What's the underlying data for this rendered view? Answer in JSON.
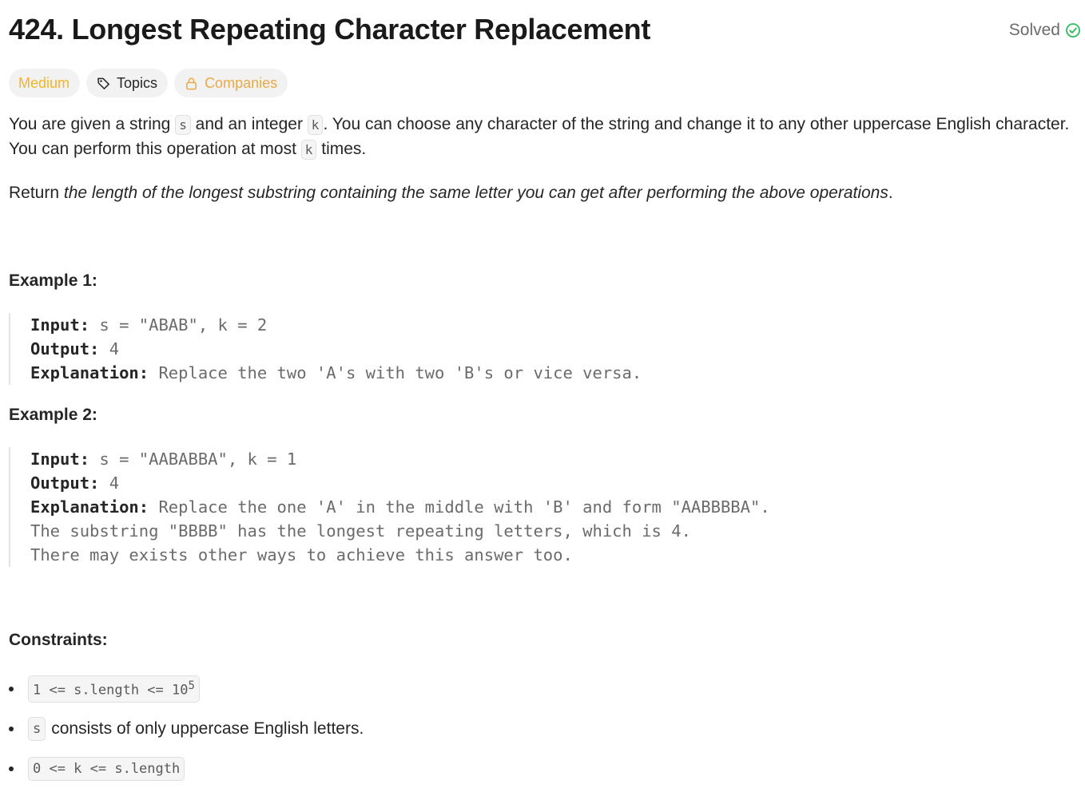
{
  "problem": {
    "title": "424. Longest Repeating Character Replacement",
    "status": "Solved",
    "tags": {
      "difficulty": "Medium",
      "topics": "Topics",
      "companies": "Companies"
    },
    "description": {
      "p1_a": "You are given a string ",
      "p1_code1": "s",
      "p1_b": " and an integer ",
      "p1_code2": "k",
      "p1_c": ". You can choose any character of the string and change it to any other uppercase English character. You can perform this operation at most ",
      "p1_code3": "k",
      "p1_d": " times.",
      "p2_a": "Return ",
      "p2_em": "the length of the longest substring containing the same letter you can get after performing the above operations",
      "p2_b": "."
    },
    "examples": [
      {
        "heading": "Example 1:",
        "input_label": "Input:",
        "input": " s = \"ABAB\", k = 2",
        "output_label": "Output:",
        "output": " 4",
        "explanation_label": "Explanation:",
        "explanation": [
          " Replace the two 'A's with two 'B's or vice versa."
        ]
      },
      {
        "heading": "Example 2:",
        "input_label": "Input:",
        "input": " s = \"AABABBA\", k = 1",
        "output_label": "Output:",
        "output": " 4",
        "explanation_label": "Explanation:",
        "explanation": [
          " Replace the one 'A' in the middle with 'B' and form \"AABBBBA\".",
          "The substring \"BBBB\" has the longest repeating letters, which is 4.",
          "There may exists other ways to achieve this answer too."
        ]
      }
    ],
    "constraints": {
      "heading": "Constraints:",
      "c1_code": "1 <= s.length <= 10",
      "c1_sup": "5",
      "c2_code": "s",
      "c2_text": " consists of only uppercase English letters.",
      "c3_code": "0 <= k <= s.length"
    }
  },
  "colors": {
    "difficulty_medium": "#f5b428",
    "solved_check": "#2cbb5d",
    "companies": "#e8a94a"
  },
  "icons": {
    "solved": "check-circle-icon",
    "topics": "tag-icon",
    "companies": "lock-icon"
  }
}
